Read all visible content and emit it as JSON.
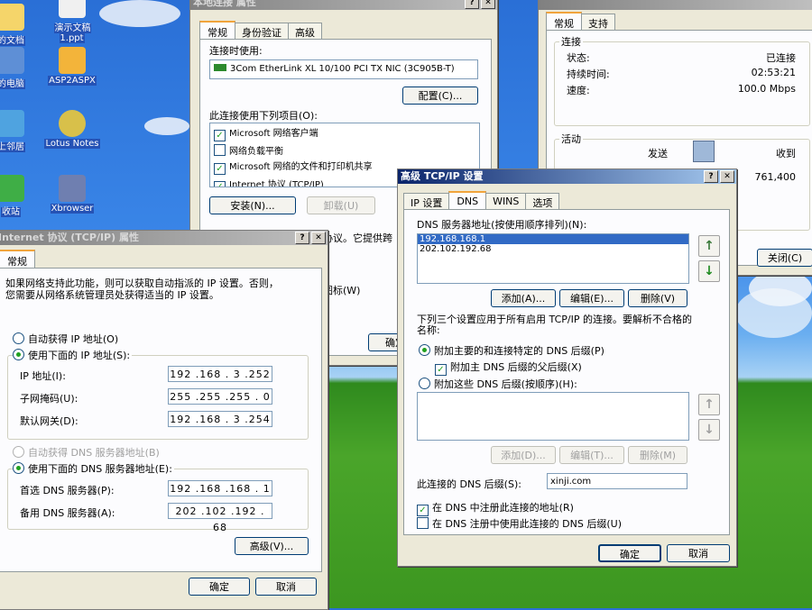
{
  "desktop": {
    "icons": [
      {
        "label": "的文档",
        "icon": "documents-icon"
      },
      {
        "label": "演示文稿\n1.ppt",
        "icon": "ppt-icon"
      },
      {
        "label": "的电脑",
        "icon": "computer-icon"
      },
      {
        "label": "ASP2ASPX",
        "icon": "asp-icon"
      },
      {
        "label": "上邻居",
        "icon": "network-icon"
      },
      {
        "label": "Lotus Notes",
        "icon": "lotus-icon"
      },
      {
        "label": "收站",
        "icon": "recycle-icon"
      },
      {
        "label": "Xbrowser",
        "icon": "xbrowser-icon"
      }
    ]
  },
  "conn_props": {
    "title": "本地连接 属性",
    "tabs": [
      "常规",
      "身份验证",
      "高级"
    ],
    "connect_using_label": "连接时使用:",
    "adapter": "3Com EtherLink XL 10/100 PCI TX NIC (3C905B-T)",
    "config_button": "配置(C)...",
    "items_label": "此连接使用下列项目(O):",
    "items": [
      {
        "label": "Microsoft 网络客户端",
        "checked": true
      },
      {
        "label": "网络负载平衡",
        "checked": false
      },
      {
        "label": "Microsoft 网络的文件和打印机共享",
        "checked": true
      },
      {
        "label": "Internet 协议 (TCP/IP)",
        "checked": true
      }
    ],
    "install_button": "安装(N)...",
    "uninstall_button": "卸载(U)",
    "desc_fragment": "协议。它提供跨",
    "icon_fragment": "图标(W)",
    "ok_fragment": "确定"
  },
  "status_win": {
    "tabs": [
      "常规",
      "支持"
    ],
    "connection_group": "连接",
    "status_label": "状态:",
    "status_value": "已连接",
    "duration_label": "持续时间:",
    "duration_value": "02:53:21",
    "speed_label": "速度:",
    "speed_value": "100.0 Mbps",
    "activity_group": "活动",
    "sent_label": "发送",
    "received_label": "收到",
    "received_value": "761,400",
    "close_button": "关闭(C)"
  },
  "tcpip_props": {
    "title": "Internet 协议 (TCP/IP) 属性",
    "tab": "常规",
    "desc": "如果网络支持此功能，则可以获取自动指派的 IP 设置。否则，\n您需要从网络系统管理员处获得适当的 IP 设置。",
    "auto_ip": "自动获得 IP 地址(O)",
    "manual_ip": "使用下面的 IP 地址(S):",
    "ip_label": "IP 地址(I):",
    "ip_value": "192 .168 . 3 .252",
    "mask_label": "子网掩码(U):",
    "mask_value": "255 .255 .255 . 0",
    "gateway_label": "默认网关(D):",
    "gateway_value": "192 .168 . 3 .254",
    "auto_dns": "自动获得 DNS 服务器地址(B)",
    "manual_dns": "使用下面的 DNS 服务器地址(E):",
    "pref_dns_label": "首选 DNS 服务器(P):",
    "pref_dns_value": "192 .168 .168 . 1",
    "alt_dns_label": "备用 DNS 服务器(A):",
    "alt_dns_value": "202 .102 .192 . 68",
    "advanced_button": "高级(V)...",
    "ok_button": "确定",
    "cancel_button": "取消"
  },
  "adv_tcpip": {
    "title": "高级 TCP/IP 设置",
    "tabs": [
      "IP 设置",
      "DNS",
      "WINS",
      "选项"
    ],
    "dns_list_label": "DNS 服务器地址(按使用顺序排列)(N):",
    "dns_servers": [
      "192.168.168.1",
      "202.102.192.68"
    ],
    "add_button": "添加(A)...",
    "edit_button": "编辑(E)...",
    "delete_button": "删除(V)",
    "note": "下列三个设置应用于所有启用 TCP/IP 的连接。要解析不合格的\n名称:",
    "append_primary": "附加主要的和连接特定的 DNS 后缀(P)",
    "append_parent": "附加主 DNS 后缀的父后缀(X)",
    "append_these": "附加这些 DNS 后缀(按顺序)(H):",
    "add2_button": "添加(D)...",
    "edit2_button": "编辑(T)...",
    "delete2_button": "删除(M)",
    "suffix_label": "此连接的 DNS 后缀(S):",
    "suffix_value": "xinji.com",
    "register": "在 DNS 中注册此连接的地址(R)",
    "use_suffix": "在 DNS 注册中使用此连接的 DNS 后缀(U)",
    "ok_button": "确定",
    "cancel_button": "取消"
  }
}
